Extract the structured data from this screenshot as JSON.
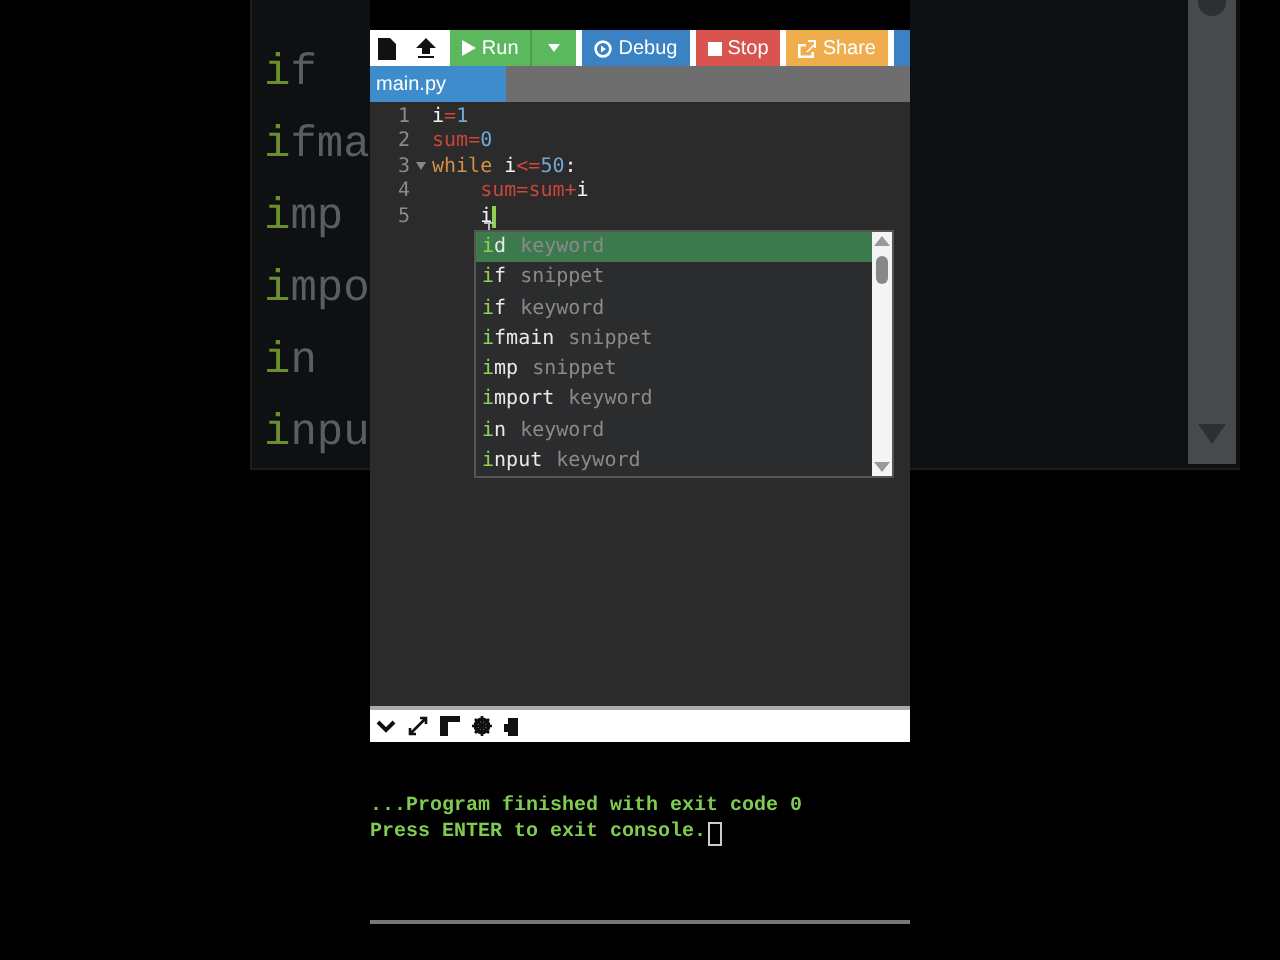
{
  "background_echo": {
    "items": [
      {
        "match": "i",
        "rest": "f"
      },
      {
        "match": "i",
        "rest": "fma"
      },
      {
        "match": "i",
        "rest": "mp"
      },
      {
        "match": "i",
        "rest": "mpo"
      },
      {
        "match": "i",
        "rest": "n"
      },
      {
        "match": "i",
        "rest": "npu"
      }
    ]
  },
  "toolbar": {
    "buttons": [
      {
        "kind": "new"
      },
      {
        "kind": "upload"
      },
      {
        "kind": "run",
        "label": "Run"
      },
      {
        "kind": "debug",
        "label": "Debug"
      },
      {
        "kind": "stop",
        "label": "Stop"
      },
      {
        "kind": "share",
        "label": "Share"
      },
      {
        "kind": "more"
      }
    ]
  },
  "tabs": [
    {
      "label": "main.py",
      "selected": true
    }
  ],
  "editor": {
    "lines": [
      {
        "number": "1",
        "fold": false,
        "tokens": [
          {
            "text": "i",
            "kind": "name"
          },
          {
            "text": "=",
            "kind": "operator"
          },
          {
            "text": "1",
            "kind": "number"
          }
        ]
      },
      {
        "number": "2",
        "fold": false,
        "tokens": [
          {
            "text": "sum",
            "kind": "variable"
          },
          {
            "text": "=",
            "kind": "operator"
          },
          {
            "text": "0",
            "kind": "number"
          }
        ]
      },
      {
        "number": "3",
        "fold": true,
        "tokens": [
          {
            "text": "while",
            "kind": "keyword"
          },
          {
            "text": " i",
            "kind": "name"
          },
          {
            "text": "<=",
            "kind": "operator"
          },
          {
            "text": "50",
            "kind": "number"
          },
          {
            "text": ":",
            "kind": "name"
          }
        ]
      },
      {
        "number": "4",
        "fold": false,
        "tokens": [
          {
            "text": "    sum",
            "kind": "variable"
          },
          {
            "text": "=",
            "kind": "operator"
          },
          {
            "text": "sum",
            "kind": "variable"
          },
          {
            "text": "+",
            "kind": "operator"
          },
          {
            "text": "i",
            "kind": "name"
          }
        ]
      },
      {
        "number": "5",
        "fold": false,
        "cursor": true,
        "tokens": [
          {
            "text": "    i",
            "kind": "name"
          }
        ]
      }
    ]
  },
  "autocomplete": {
    "items": [
      {
        "match": "i",
        "rest": "d",
        "meta": "keyword",
        "selected": true
      },
      {
        "match": "i",
        "rest": "f",
        "meta": "snippet",
        "selected": false
      },
      {
        "match": "i",
        "rest": "f",
        "meta": "keyword",
        "selected": false
      },
      {
        "match": "i",
        "rest": "fmain",
        "meta": "snippet",
        "selected": false
      },
      {
        "match": "i",
        "rest": "mp",
        "meta": "snippet",
        "selected": false
      },
      {
        "match": "i",
        "rest": "mport",
        "meta": "keyword",
        "selected": false
      },
      {
        "match": "i",
        "rest": "n",
        "meta": "keyword",
        "selected": false
      },
      {
        "match": "i",
        "rest": "nput",
        "meta": "keyword",
        "selected": false
      }
    ]
  },
  "console": {
    "lines": [
      "...Program finished with exit code 0",
      "Press ENTER to exit console."
    ]
  }
}
